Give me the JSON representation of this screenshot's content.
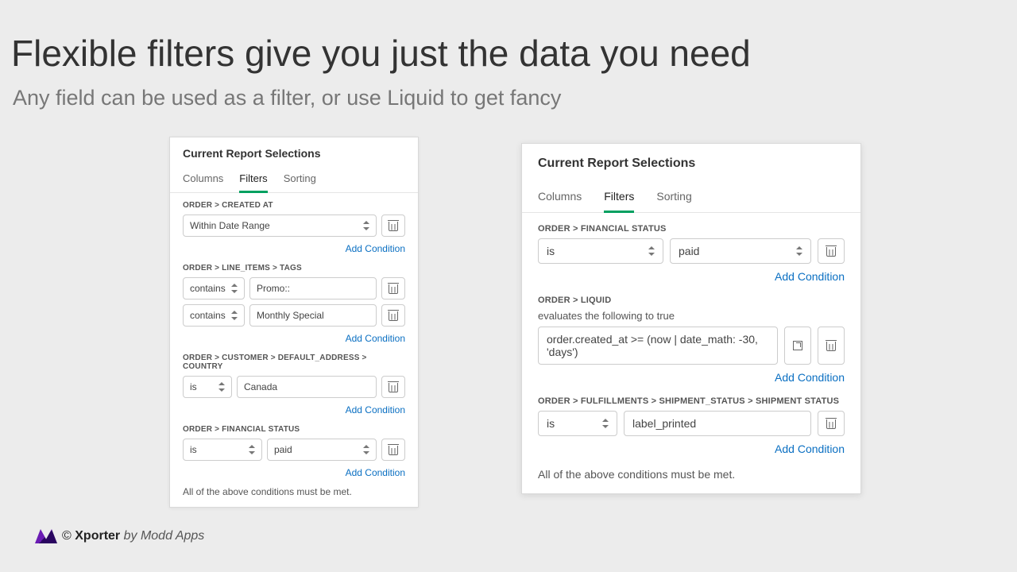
{
  "headline": "Flexible filters give you just the data you need",
  "subhead": "Any field can be used as a filter, or use Liquid to get fancy",
  "tabs": {
    "columns": "Columns",
    "filters": "Filters",
    "sorting": "Sorting"
  },
  "addCondition": "Add Condition",
  "left": {
    "title": "Current Report Selections",
    "note": "All of the above conditions must be met.",
    "g1": {
      "label": "ORDER > CREATED AT",
      "sel": "Within Date Range"
    },
    "g2": {
      "label": "ORDER > LINE_ITEMS > TAGS",
      "r1op": "contains",
      "r1val": "Promo::",
      "r2op": "contains",
      "r2val": "Monthly Special"
    },
    "g3": {
      "label": "ORDER > CUSTOMER > DEFAULT_ADDRESS > COUNTRY",
      "op": "is",
      "val": "Canada"
    },
    "g4": {
      "label": "ORDER > FINANCIAL STATUS",
      "op": "is",
      "val": "paid"
    }
  },
  "right": {
    "title": "Current Report Selections",
    "note": "All of the above conditions must be met.",
    "g1": {
      "label": "ORDER > FINANCIAL STATUS",
      "op": "is",
      "val": "paid"
    },
    "g2": {
      "label": "ORDER > LIQUID",
      "helper": "evaluates the following to true",
      "expr": "order.created_at >= (now | date_math: -30, 'days')"
    },
    "g3": {
      "label": "ORDER > FULFILLMENTS > SHIPMENT_STATUS > SHIPMENT STATUS",
      "op": "is",
      "val": "label_printed"
    }
  },
  "footer": {
    "copy": "©",
    "name": "Xporter",
    "by": "by Modd Apps"
  }
}
